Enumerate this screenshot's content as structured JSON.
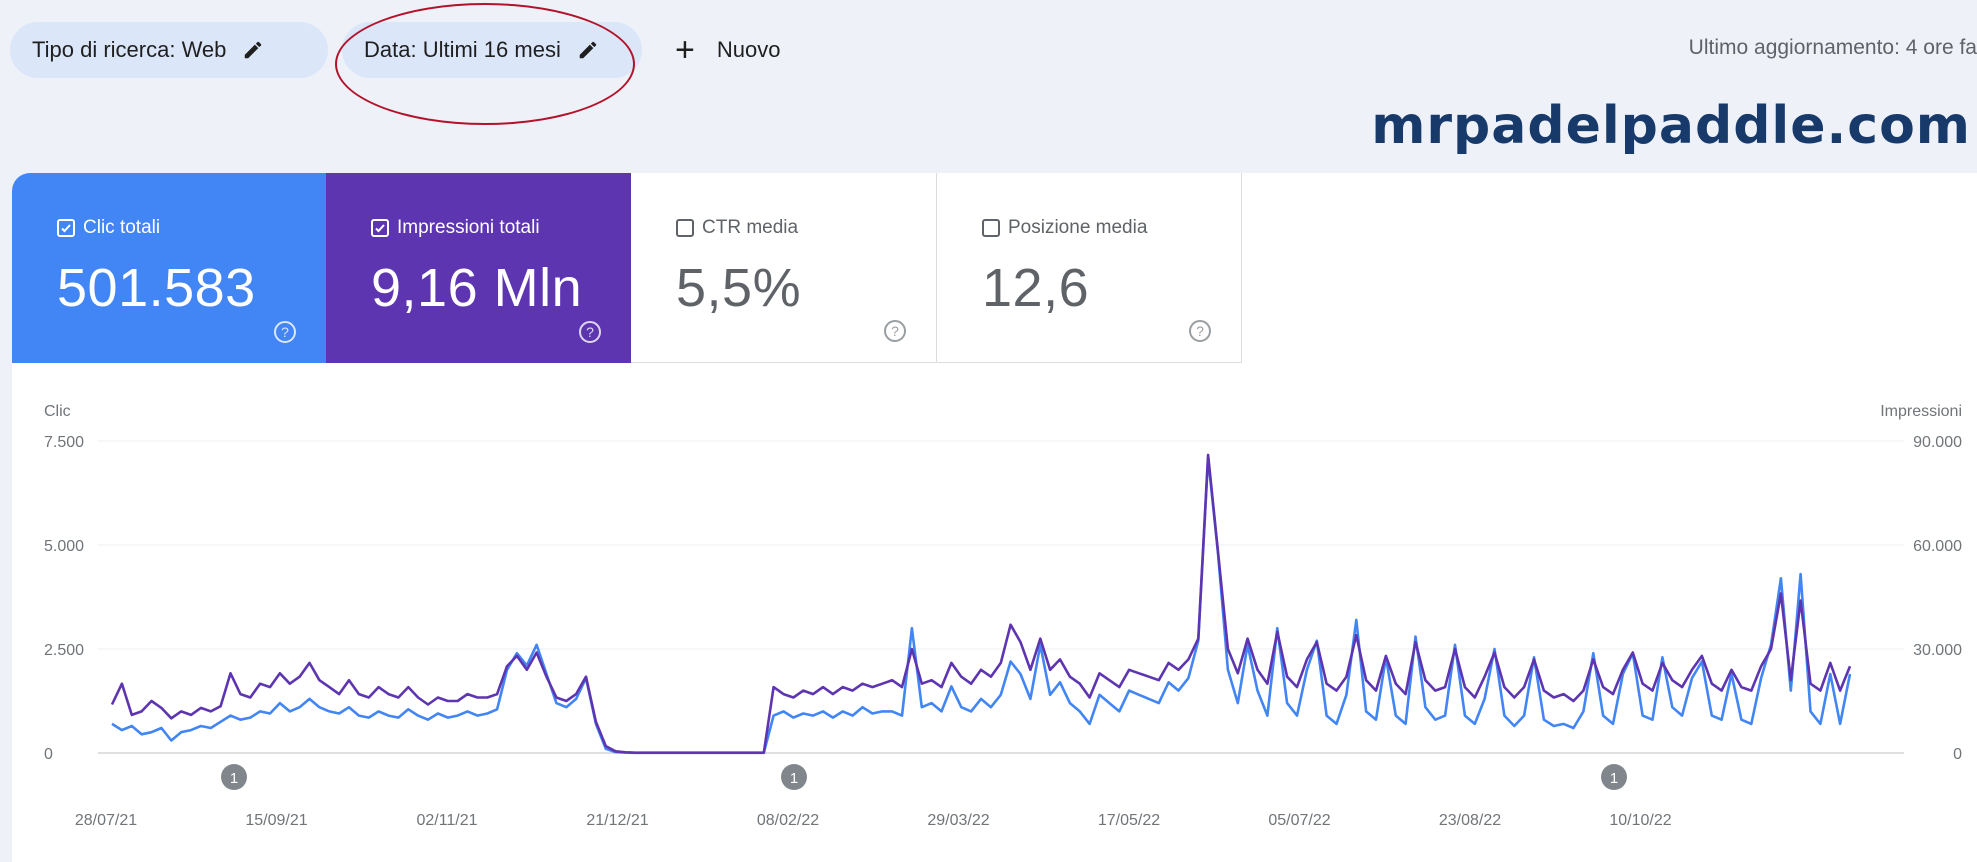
{
  "toolbar": {
    "search_type": "Tipo di ricerca: Web",
    "date_range": "Data: Ultimi 16 mesi",
    "new_label": "Nuovo",
    "last_updated": "Ultimo aggiornamento: 4 ore fa"
  },
  "watermark": "mrpadelpaddle.com",
  "metrics": [
    {
      "label": "Clic totali",
      "value": "501.583",
      "checked": true,
      "color": "#4285f4"
    },
    {
      "label": "Impressioni totali",
      "value": "9,16 Mln",
      "checked": true,
      "color": "#5e35b1"
    },
    {
      "label": "CTR media",
      "value": "5,5%",
      "checked": false
    },
    {
      "label": "Posizione media",
      "value": "12,6",
      "checked": false
    }
  ],
  "chart_data": {
    "type": "line",
    "left_axis_label": "Clic",
    "right_axis_label": "Impressioni",
    "y_left_ticks": [
      "7.500",
      "5.000",
      "2.500",
      "0"
    ],
    "y_right_ticks": [
      "90.000",
      "60.000",
      "30.000",
      "0"
    ],
    "ylim_left": [
      0,
      7500
    ],
    "ylim_right": [
      0,
      90000
    ],
    "x_tick_labels": [
      "28/07/21",
      "15/09/21",
      "02/11/21",
      "21/12/21",
      "08/02/22",
      "29/03/22",
      "17/05/22",
      "05/07/22",
      "23/08/22",
      "10/10/22"
    ],
    "annotation_markers": [
      "1",
      "1",
      "1"
    ],
    "grid": true,
    "series": [
      {
        "name": "Clic",
        "axis": "left",
        "color": "#4285f4",
        "values": [
          700,
          550,
          650,
          450,
          500,
          600,
          300,
          500,
          550,
          650,
          600,
          750,
          900,
          800,
          850,
          1000,
          950,
          1200,
          1000,
          1100,
          1300,
          1100,
          1000,
          950,
          1100,
          900,
          850,
          1000,
          900,
          850,
          1050,
          900,
          800,
          950,
          850,
          900,
          1000,
          900,
          950,
          1050,
          2000,
          2400,
          2100,
          2600,
          1900,
          1200,
          1100,
          1300,
          1800,
          700,
          100,
          20,
          10,
          5,
          5,
          5,
          5,
          5,
          5,
          5,
          5,
          5,
          5,
          5,
          5,
          5,
          5,
          900,
          1000,
          850,
          950,
          900,
          1000,
          850,
          1000,
          900,
          1100,
          950,
          1000,
          1000,
          900,
          3000,
          1100,
          1200,
          1000,
          1600,
          1100,
          1000,
          1300,
          1100,
          1400,
          2200,
          1900,
          1300,
          2600,
          1400,
          1700,
          1200,
          1000,
          700,
          1400,
          1200,
          1000,
          1500,
          1400,
          1300,
          1200,
          1700,
          1500,
          1800,
          2700,
          7100,
          4800,
          2000,
          1200,
          2600,
          1500,
          900,
          3000,
          1200,
          900,
          2000,
          2700,
          900,
          700,
          1400,
          3200,
          1000,
          800,
          2300,
          900,
          700,
          2800,
          1100,
          800,
          900,
          2600,
          900,
          700,
          1300,
          2500,
          900,
          650,
          900,
          2300,
          800,
          650,
          700,
          600,
          1000,
          2400,
          900,
          700,
          1900,
          2400,
          900,
          800,
          2300,
          1100,
          900,
          1800,
          2200,
          900,
          800,
          1900,
          800,
          700,
          1800,
          2600,
          4200,
          1500,
          4300,
          1000,
          700,
          1900,
          700,
          1900
        ]
      },
      {
        "name": "Impressioni",
        "axis": "right",
        "color": "#5e35b1",
        "values": [
          14000,
          20000,
          11000,
          12000,
          15000,
          13000,
          10000,
          12000,
          11000,
          13000,
          12000,
          13500,
          23000,
          17000,
          16000,
          20000,
          19000,
          23000,
          20000,
          22000,
          26000,
          21000,
          19000,
          17000,
          21000,
          17000,
          16000,
          19000,
          17000,
          16000,
          19000,
          16000,
          14000,
          16000,
          15000,
          15000,
          17000,
          16000,
          16000,
          17000,
          25000,
          28000,
          24000,
          29000,
          22000,
          16000,
          15000,
          17000,
          22000,
          9000,
          2000,
          500,
          200,
          100,
          100,
          100,
          100,
          100,
          100,
          100,
          100,
          100,
          100,
          100,
          100,
          100,
          100,
          19000,
          17000,
          16000,
          18000,
          17000,
          19000,
          17000,
          19000,
          18000,
          20000,
          19000,
          20000,
          21000,
          19000,
          30000,
          20000,
          21000,
          19000,
          26000,
          22000,
          20000,
          24000,
          22000,
          26000,
          37000,
          32000,
          24000,
          33000,
          24000,
          27000,
          22000,
          20000,
          16000,
          23000,
          21000,
          19000,
          24000,
          23000,
          22000,
          21000,
          26000,
          24000,
          27000,
          33000,
          86000,
          58000,
          30000,
          23000,
          33000,
          24000,
          20000,
          35000,
          22000,
          19000,
          27000,
          32000,
          20000,
          18000,
          22000,
          34000,
          21000,
          18000,
          28000,
          20000,
          17000,
          32000,
          21000,
          18000,
          19000,
          30000,
          19000,
          16000,
          22000,
          29000,
          19000,
          16000,
          19000,
          27000,
          18000,
          16000,
          17000,
          15000,
          18000,
          27000,
          19000,
          17000,
          24000,
          29000,
          20000,
          18000,
          26000,
          21000,
          19000,
          24000,
          28000,
          20000,
          18000,
          24000,
          19000,
          18000,
          25000,
          30000,
          46000,
          21000,
          44000,
          20000,
          18000,
          26000,
          18000,
          25000
        ]
      }
    ]
  }
}
